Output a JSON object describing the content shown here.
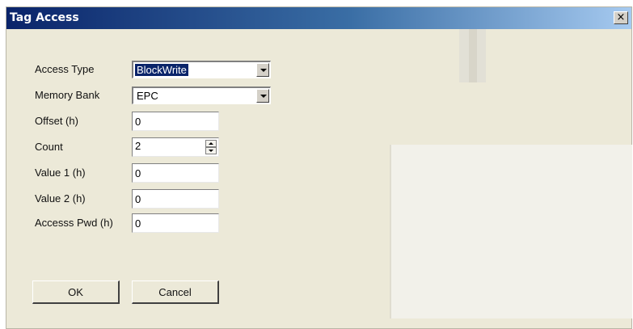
{
  "window": {
    "title": "Tag Access",
    "close_label": "×"
  },
  "form": {
    "access_type": {
      "label": "Access Type",
      "value": "BlockWrite"
    },
    "memory_bank": {
      "label": "Memory Bank",
      "value": "EPC"
    },
    "offset": {
      "label": "Offset (h)",
      "value": "0"
    },
    "count": {
      "label": "Count",
      "value": "2"
    },
    "value1": {
      "label": "Value 1 (h)",
      "value": "0"
    },
    "value2": {
      "label": "Value 2 (h)",
      "value": "0"
    },
    "access_pwd": {
      "label": "Accesss Pwd (h)",
      "value": "0"
    }
  },
  "buttons": {
    "ok": "OK",
    "cancel": "Cancel"
  }
}
